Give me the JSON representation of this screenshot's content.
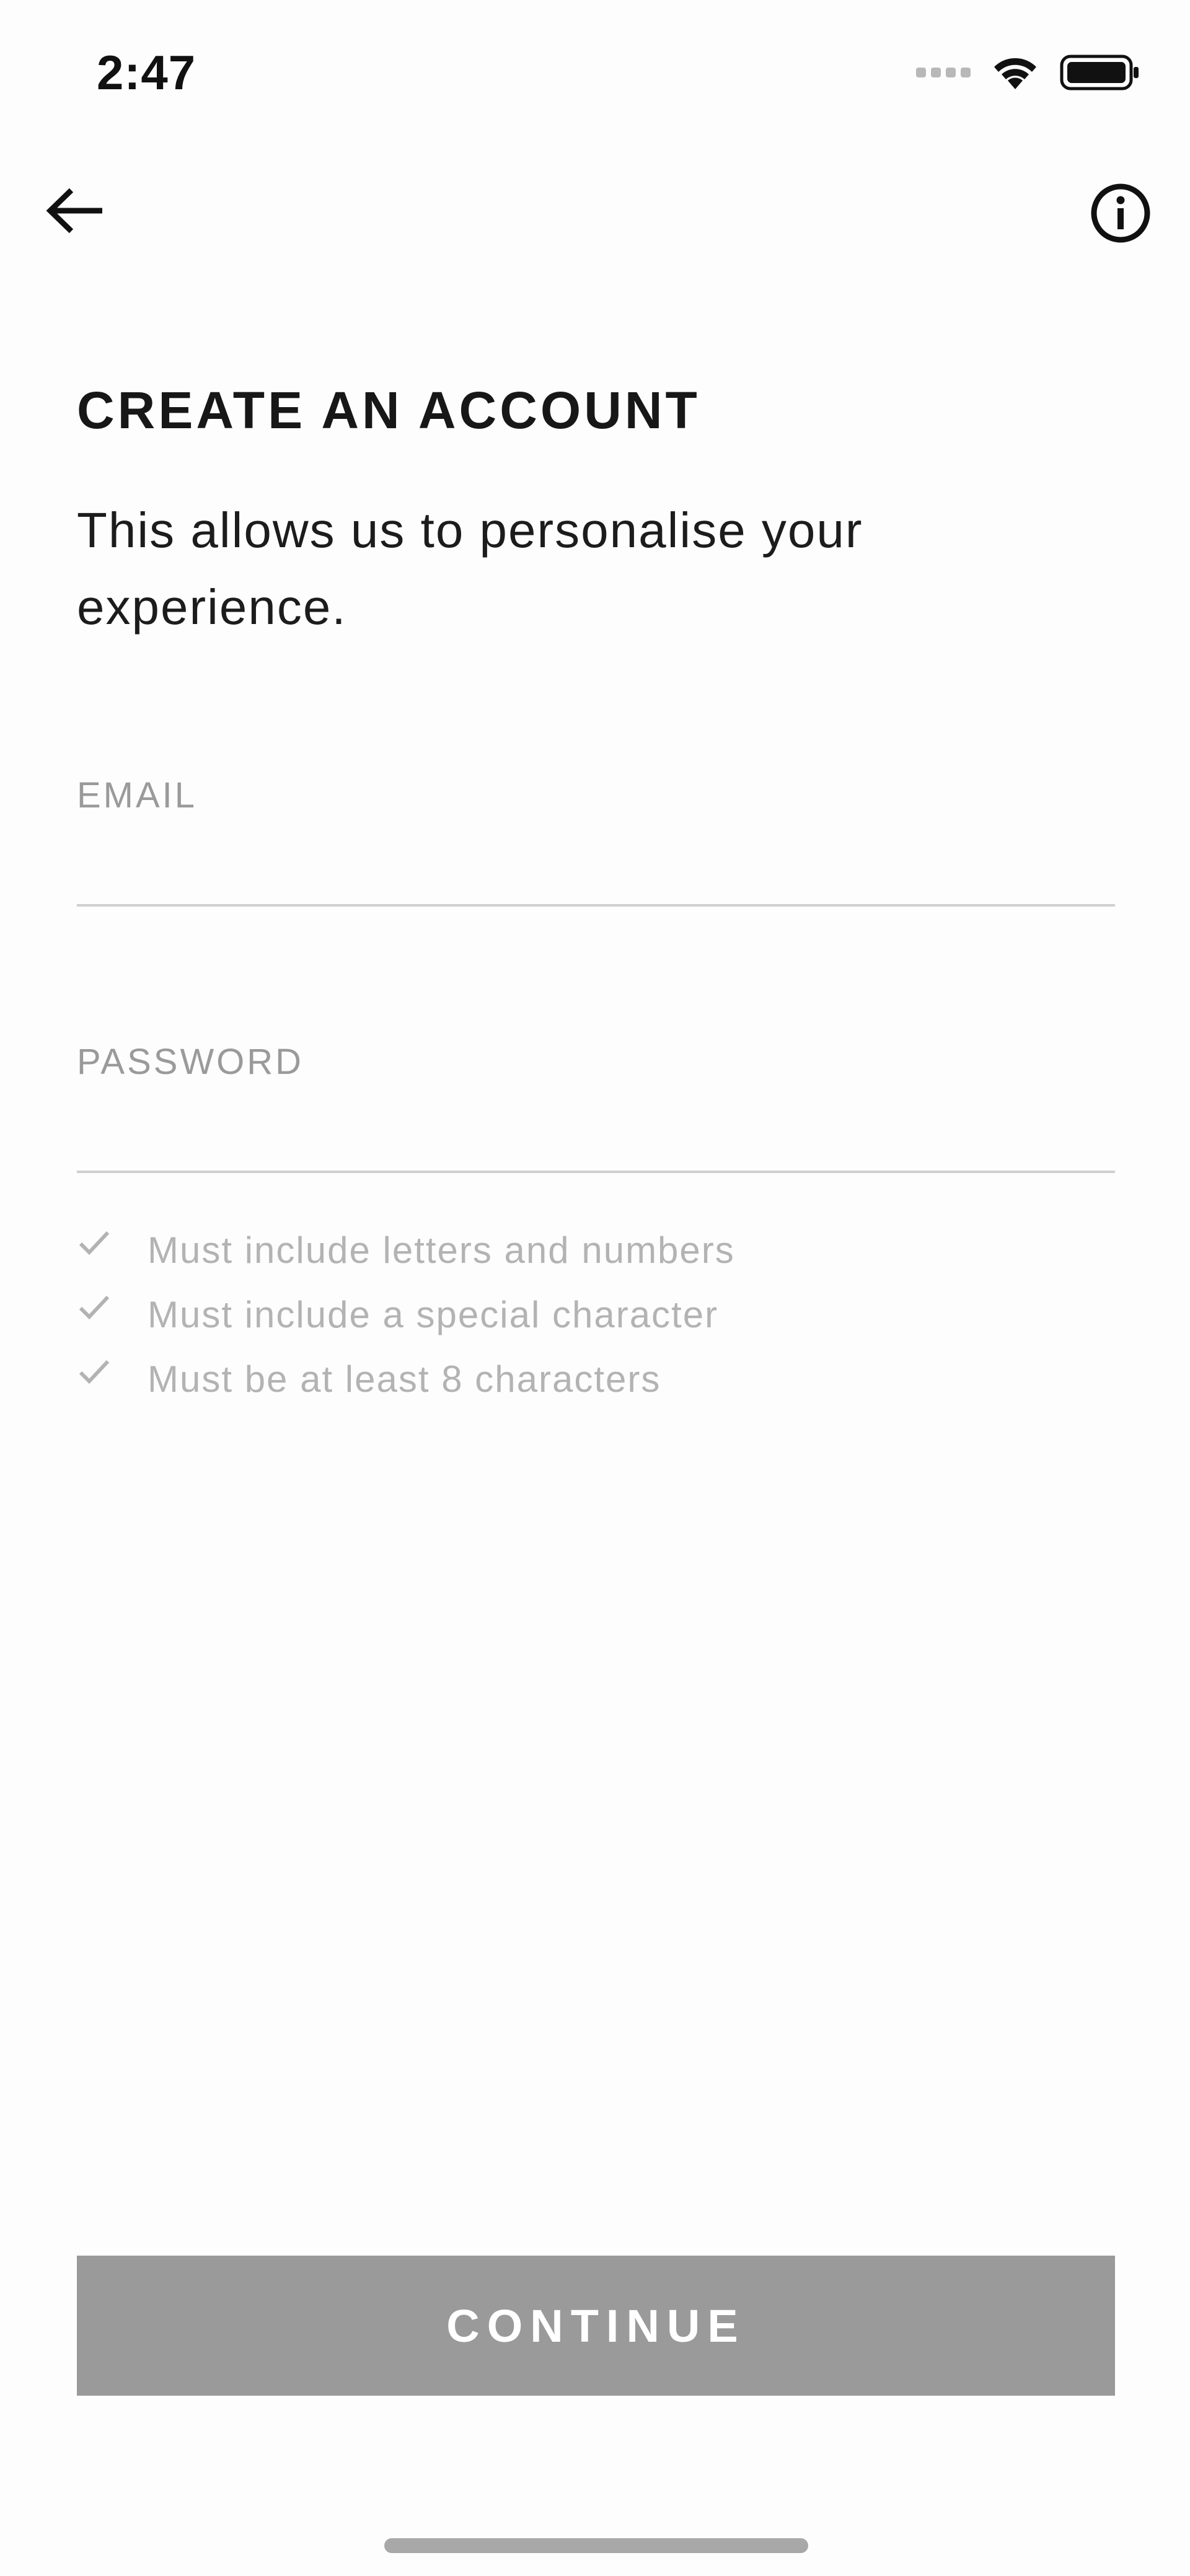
{
  "status_bar": {
    "time": "2:47"
  },
  "nav": {
    "back_icon": "arrow-left-icon",
    "info_icon": "info-circle-icon"
  },
  "header": {
    "title": "CREATE AN ACCOUNT",
    "subtitle": "This allows us to personalise your experience."
  },
  "form": {
    "email": {
      "label": "EMAIL",
      "value": "",
      "placeholder": ""
    },
    "password": {
      "label": "PASSWORD",
      "value": "",
      "placeholder": ""
    },
    "rules": [
      {
        "text": "Must include letters and numbers",
        "icon": "check-icon"
      },
      {
        "text": "Must include a special character",
        "icon": "check-icon"
      },
      {
        "text": "Must be at least 8 characters",
        "icon": "check-icon"
      }
    ]
  },
  "actions": {
    "continue_label": "CONTINUE"
  },
  "colors": {
    "background": "#fdfdfd",
    "text_primary": "#1a1a1a",
    "label_grey": "#9a9a9a",
    "rule_grey": "#b3b3b3",
    "button_disabled": "#9a9a9a",
    "button_text": "#ffffff"
  }
}
